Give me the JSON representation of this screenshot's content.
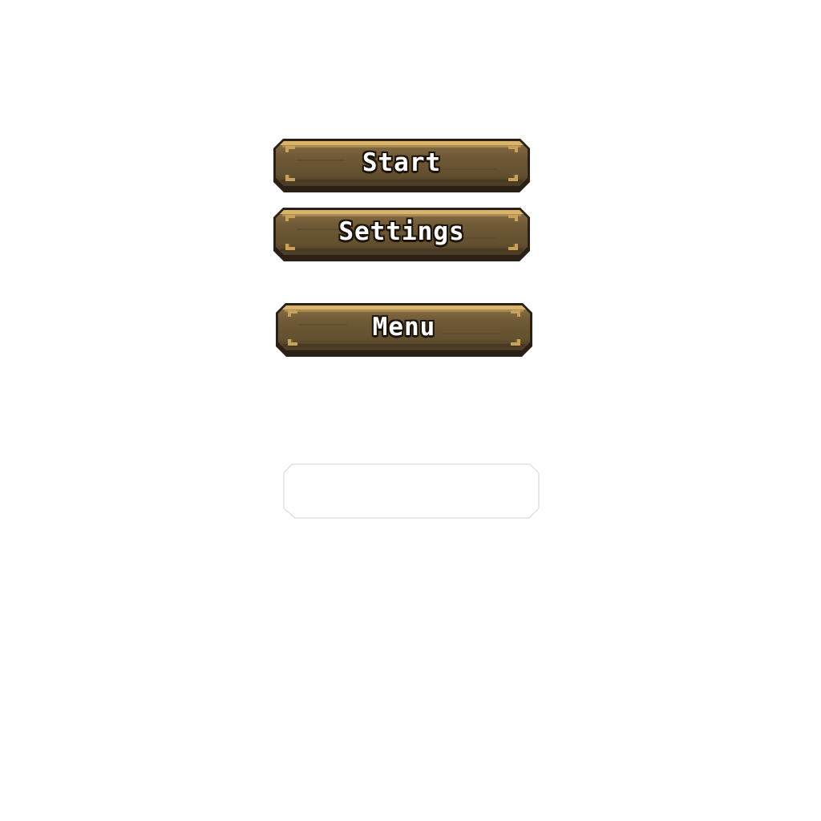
{
  "menu": {
    "buttons": [
      {
        "id": "start",
        "label": "Start"
      },
      {
        "id": "settings",
        "label": "Settings"
      },
      {
        "id": "menu",
        "label": "Menu"
      }
    ]
  },
  "colors": {
    "wood_body": "#6b5535",
    "wood_top": "#8a7043",
    "wood_highlight": "#d8b56a",
    "wood_shadow": "#3f3120",
    "outline": "#2a2015",
    "rivet": "#c9a25a",
    "label_text": "#ffffff",
    "label_outline": "#1c1408",
    "empty_slot_border": "#d9d9d9"
  },
  "icons": {
    "corner_rivet": "corner-rivet-icon"
  }
}
